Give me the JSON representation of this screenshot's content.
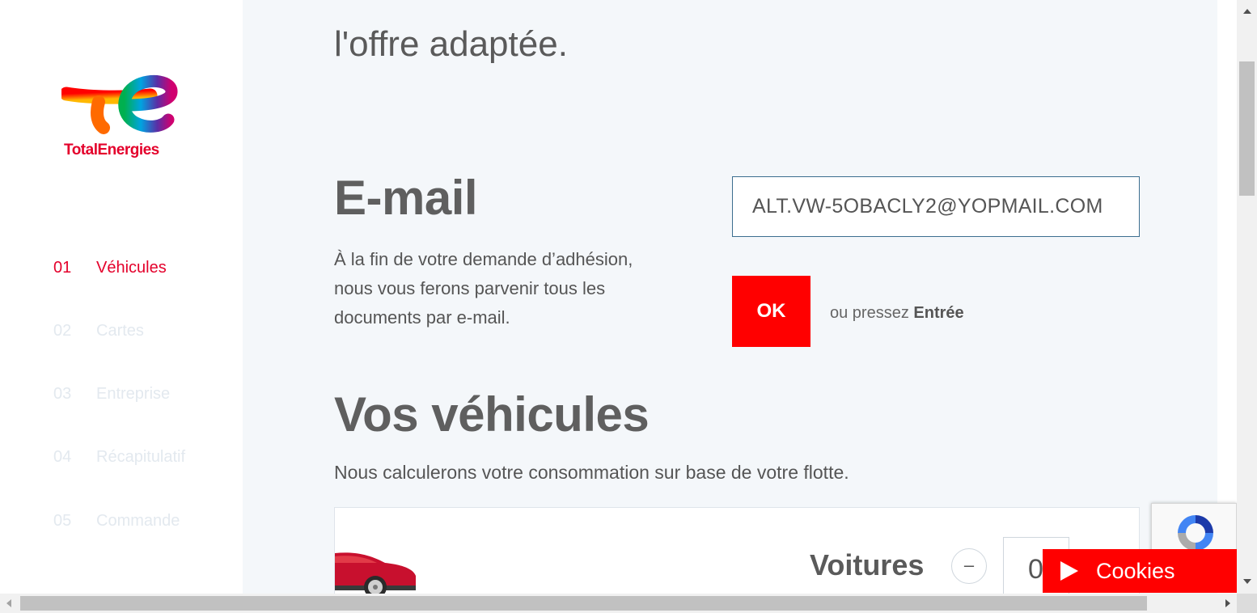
{
  "brand": {
    "name": "TotalEnergies",
    "logo_icon": "totalenergies-logo-icon",
    "accent_color": "#e4002b"
  },
  "steps": [
    {
      "number": "01",
      "label": "Véhicules",
      "active": true
    },
    {
      "number": "02",
      "label": "Cartes",
      "active": false
    },
    {
      "number": "03",
      "label": "Entreprise",
      "active": false
    },
    {
      "number": "04",
      "label": "Récapitulatif",
      "active": false
    },
    {
      "number": "05",
      "label": "Commande",
      "active": false
    }
  ],
  "intro": {
    "lead": "l'offre adaptée."
  },
  "email": {
    "title": "E-mail",
    "description": "À la fin de votre demande d’adhésion, nous vous ferons parvenir tous les documents par e-mail.",
    "value": "ALT.VW-5OBACLY2@YOPMAIL.COM",
    "ok_label": "OK",
    "hint_prefix": "ou pressez",
    "hint_key": "Entrée"
  },
  "vehicles": {
    "title": "Vos véhicules",
    "description": "Nous calculerons votre consommation sur base de votre flotte.",
    "items": [
      {
        "label": "Voitures",
        "count": "0",
        "icon": "car-icon"
      }
    ],
    "minus_symbol": "–"
  },
  "cookies": {
    "label": "Cookies",
    "icon": "play-icon"
  },
  "recaptcha": {
    "icon": "recaptcha-icon"
  }
}
